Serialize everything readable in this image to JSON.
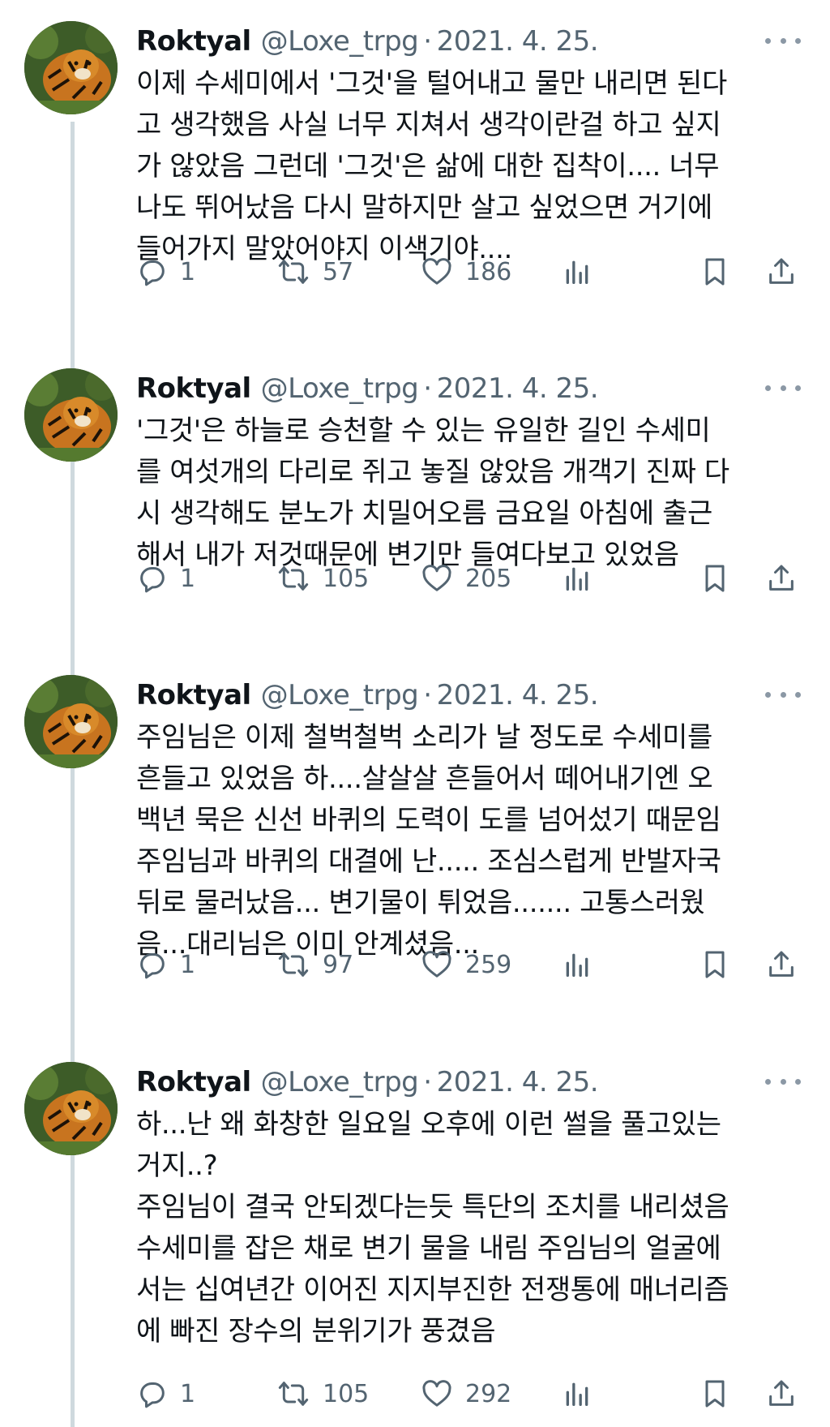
{
  "tweets": [
    {
      "name": "Roktyal",
      "handle": "@Loxe_trpg",
      "separator": "·",
      "date": "2021. 4. 25.",
      "text": "이제 수세미에서 '그것'을 털어내고 물만 내리면 된다\n고 생각했음 사실 너무 지쳐서 생각이란걸 하고 싶지\n가 않았음 그런데 '그것'은 삶에 대한 집착이.... 너무\n나도 뛰어났음 다시 말하지만 살고 싶었으면 거기에\n들어가지 말았어야지 이색기야....",
      "replies": "1",
      "retweets": "57",
      "likes": "186"
    },
    {
      "name": "Roktyal",
      "handle": "@Loxe_trpg",
      "separator": "·",
      "date": "2021. 4. 25.",
      "text": "'그것'은 하늘로 승천할 수 있는 유일한 길인 수세미\n를 여섯개의 다리로 쥐고 놓질 않았음 개객기 진짜 다\n시 생각해도 분노가 치밀어오름 금요일 아침에 출근\n해서 내가 저것때문에 변기만 들여다보고 있었음",
      "replies": "1",
      "retweets": "105",
      "likes": "205"
    },
    {
      "name": "Roktyal",
      "handle": "@Loxe_trpg",
      "separator": "·",
      "date": "2021. 4. 25.",
      "text": "주임님은 이제 철벅철벅 소리가 날 정도로 수세미를\n흔들고 있었음 하....살살살 흔들어서 떼어내기엔 오\n백년 묵은 신선 바퀴의 도력이 도를 넘어섰기 때문임\n주임님과 바퀴의 대결에 난..... 조심스럽게 반발자국\n뒤로 물러났음... 변기물이 튀었음....... 고통스러웠\n음...대리님은 이미 안계셨음...",
      "replies": "1",
      "retweets": "97",
      "likes": "259"
    },
    {
      "name": "Roktyal",
      "handle": "@Loxe_trpg",
      "separator": "·",
      "date": "2021. 4. 25.",
      "text": "하...난 왜 화창한 일요일 오후에 이런 썰을 풀고있는\n거지..?\n주임님이 결국 안되겠다는듯 특단의 조치를 내리셨음\n수세미를 잡은 채로 변기 물을 내림 주임님의 얼굴에\n서는 십여년간 이어진 지지부진한 전쟁통에 매너리즘\n에 빠진 장수의 분위기가 풍겼음",
      "replies": "1",
      "retweets": "105",
      "likes": "292"
    }
  ],
  "icons": {
    "reply": "reply-icon",
    "retweet": "retweet-icon",
    "like": "heart-icon",
    "views": "analytics-icon",
    "bookmark": "bookmark-icon",
    "share": "share-icon",
    "more": "more-icon",
    "avatar": "tiger-avatar"
  },
  "colors": {
    "text": "#0f1419",
    "secondary": "#536471",
    "thread_line": "#cfd9de",
    "background": "#ffffff"
  }
}
